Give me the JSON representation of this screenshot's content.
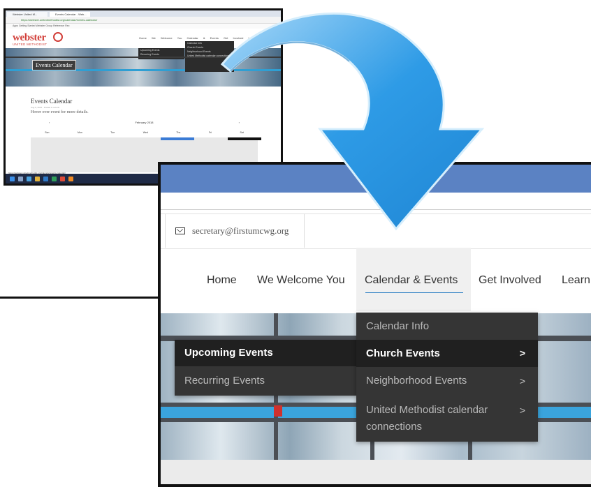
{
  "small_screenshot": {
    "tabs": [
      "Webster United M...",
      "Events Calendar - Web..."
    ],
    "url": "https://webster.unitedmethodist.org/calendar/events-calendar/",
    "bookmarks": "Apps   Getting Started   Webster Group   Reference   Rec",
    "logo_main": "webster",
    "logo_sub": "UNITED METHODIST",
    "nav": "Home   We Welcome You   Calendar & Events   Get Involved   Learning   Contact",
    "hero_title": "Events Calendar",
    "dropdown_left": [
      "Upcoming Events",
      "Recurring Events"
    ],
    "dropdown_right": [
      "Calendar Info",
      "Church Events",
      "Neighborhood Events",
      "United Methodist calendar connections"
    ],
    "page_title": "Events Calendar",
    "page_meta": "Aug 9, 2016 · Posted in events",
    "page_hint": "Hover over event for more details.",
    "cal_month": "February 2018",
    "cal_prev": "‹",
    "cal_next": "›",
    "cal_days": [
      "Sun",
      "Mon",
      "Tue",
      "Wed",
      "Thu",
      "Fri",
      "Sat"
    ],
    "status_url": "https://webster.unitedmethodist.org/calendar/events-calendar/"
  },
  "large_screenshot": {
    "email": "secretary@firstumcwg.org",
    "nav": {
      "home": "Home",
      "welcome": "We Welcome You",
      "calendar": "Calendar & Events",
      "involved": "Get Involved",
      "learn": "Learn"
    },
    "dropdown_left": {
      "upcoming": "Upcoming Events",
      "recurring": "Recurring Events"
    },
    "dropdown_right": {
      "calendar_info": "Calendar Info",
      "church_events": "Church Events",
      "neighborhood": "Neighborhood Events",
      "umc_line1": "United Methodist calendar",
      "umc_line2": "connections",
      "chevron": ">"
    }
  },
  "colors": {
    "arrow_fill": "#2e9be6",
    "arrow_edge": "#a8d8f8",
    "titlebar": "#5b82c3",
    "accent_underline": "#2e7fc4",
    "dropdown_bg": "#353535"
  }
}
